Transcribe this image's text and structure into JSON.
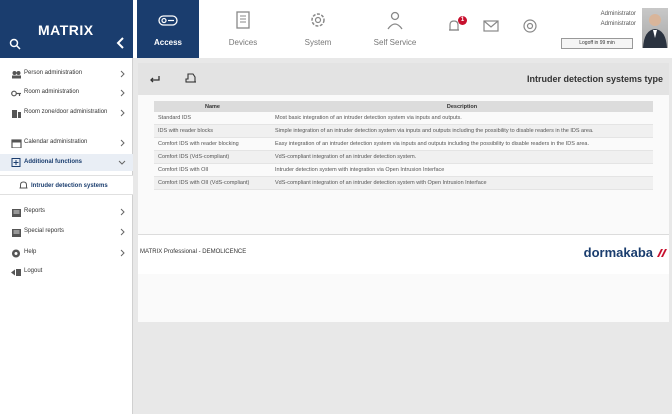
{
  "app": {
    "brand": "MATRIX"
  },
  "nav": [
    {
      "label": "Access",
      "icon": "key-card-icon",
      "active": true
    },
    {
      "label": "Devices",
      "icon": "device-icon",
      "active": false
    },
    {
      "label": "System",
      "icon": "gear-icon",
      "active": false
    },
    {
      "label": "Self Service",
      "icon": "person-service-icon",
      "active": false
    }
  ],
  "header": {
    "notification_count": "1",
    "user_name": "Administrator",
    "user_role": "Administrator",
    "logoff_label": "Logoff in 99 min"
  },
  "sidebar": {
    "items": [
      {
        "label": "Person administration",
        "icon": "people-icon"
      },
      {
        "label": "Room administration",
        "icon": "room-key-icon"
      },
      {
        "label": "Room zone/door administration",
        "icon": "door-zone-icon"
      },
      {
        "label": "Calendar administration",
        "icon": "calendar-icon"
      },
      {
        "label": "Additional functions",
        "icon": "plus-box-icon"
      },
      {
        "label": "Intruder detection systems",
        "icon": "bell-icon"
      },
      {
        "label": "Reports",
        "icon": "report-icon"
      },
      {
        "label": "Special reports",
        "icon": "special-report-icon"
      },
      {
        "label": "Help",
        "icon": "help-icon"
      },
      {
        "label": "Logout",
        "icon": "logout-icon"
      }
    ]
  },
  "page": {
    "title": "Intruder detection systems type"
  },
  "table": {
    "headers": {
      "name": "Name",
      "description": "Description"
    },
    "rows": [
      {
        "name": "Standard IDS",
        "description": "Most basic integration of an intruder detection system via inputs and outputs."
      },
      {
        "name": "IDS with reader blocks",
        "description": "Simple integration of an intruder detection system via inputs and outputs including the possibility to disable readers in the IDS area."
      },
      {
        "name": "Comfort IDS with reader blocking",
        "description": "Easy integration of an intruder detection system via inputs and outputs including the possibility to disable readers in the IDS area."
      },
      {
        "name": "Comfort IDS (VdS-compliant)",
        "description": "VdS-compliant integration of an intruder detection system."
      },
      {
        "name": "Comfort IDS with OII",
        "description": "Intruder detection system with integration via Open Intrusion Interface"
      },
      {
        "name": "Comfort IDS with OII (VdS-compliant)",
        "description": "VdS-compliant integration of an intruder detection system with Open Intrusion Interface"
      }
    ]
  },
  "footer": {
    "product": "MATRIX Professional - DEMOLICENCE",
    "logo": "dormakaba"
  },
  "colors": {
    "brand": "#1a3d6e",
    "accent": "#c8102e"
  }
}
